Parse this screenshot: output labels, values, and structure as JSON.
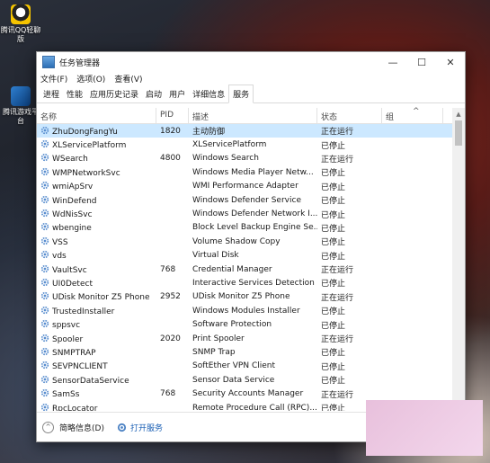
{
  "desktop": {
    "icons": [
      {
        "label": "腾讯QQ轻聊版"
      },
      {
        "label": "腾讯游戏平台"
      }
    ]
  },
  "window": {
    "title": "任务管理器",
    "controls": {
      "minimize": "—",
      "maximize": "☐",
      "close": "✕"
    }
  },
  "menu": [
    "文件(F)",
    "选项(O)",
    "查看(V)"
  ],
  "tabs": [
    "进程",
    "性能",
    "应用历史记录",
    "启动",
    "用户",
    "详细信息",
    "服务"
  ],
  "active_tab": "服务",
  "columns": {
    "name": "名称",
    "pid": "PID",
    "desc": "描述",
    "status": "状态",
    "group": "组"
  },
  "rows": [
    {
      "name": "ZhuDongFangYu",
      "pid": "1820",
      "desc": "主动防御",
      "status": "正在运行",
      "selected": true
    },
    {
      "name": "XLServicePlatform",
      "pid": "",
      "desc": "XLServicePlatform",
      "status": "已停止"
    },
    {
      "name": "WSearch",
      "pid": "4800",
      "desc": "Windows Search",
      "status": "正在运行"
    },
    {
      "name": "WMPNetworkSvc",
      "pid": "",
      "desc": "Windows Media Player Netw...",
      "status": "已停止"
    },
    {
      "name": "wmiApSrv",
      "pid": "",
      "desc": "WMI Performance Adapter",
      "status": "已停止"
    },
    {
      "name": "WinDefend",
      "pid": "",
      "desc": "Windows Defender Service",
      "status": "已停止"
    },
    {
      "name": "WdNisSvc",
      "pid": "",
      "desc": "Windows Defender Network I...",
      "status": "已停止"
    },
    {
      "name": "wbengine",
      "pid": "",
      "desc": "Block Level Backup Engine Se...",
      "status": "已停止"
    },
    {
      "name": "VSS",
      "pid": "",
      "desc": "Volume Shadow Copy",
      "status": "已停止"
    },
    {
      "name": "vds",
      "pid": "",
      "desc": "Virtual Disk",
      "status": "已停止"
    },
    {
      "name": "VaultSvc",
      "pid": "768",
      "desc": "Credential Manager",
      "status": "正在运行"
    },
    {
      "name": "UI0Detect",
      "pid": "",
      "desc": "Interactive Services Detection",
      "status": "已停止"
    },
    {
      "name": "UDisk Monitor Z5 Phone",
      "pid": "2952",
      "desc": "UDisk Monitor Z5 Phone",
      "status": "正在运行"
    },
    {
      "name": "TrustedInstaller",
      "pid": "",
      "desc": "Windows Modules Installer",
      "status": "已停止"
    },
    {
      "name": "sppsvc",
      "pid": "",
      "desc": "Software Protection",
      "status": "已停止"
    },
    {
      "name": "Spooler",
      "pid": "2020",
      "desc": "Print Spooler",
      "status": "正在运行"
    },
    {
      "name": "SNMPTRAP",
      "pid": "",
      "desc": "SNMP Trap",
      "status": "已停止"
    },
    {
      "name": "SEVPNCLIENT",
      "pid": "",
      "desc": "SoftEther VPN Client",
      "status": "已停止"
    },
    {
      "name": "SensorDataService",
      "pid": "",
      "desc": "Sensor Data Service",
      "status": "已停止"
    },
    {
      "name": "SamSs",
      "pid": "768",
      "desc": "Security Accounts Manager",
      "status": "正在运行"
    },
    {
      "name": "RpcLocator",
      "pid": "",
      "desc": "Remote Procedure Call (RPC)...",
      "status": "已停止"
    }
  ],
  "footer": {
    "summary": "简略信息(D)",
    "open_services": "打开服务"
  }
}
